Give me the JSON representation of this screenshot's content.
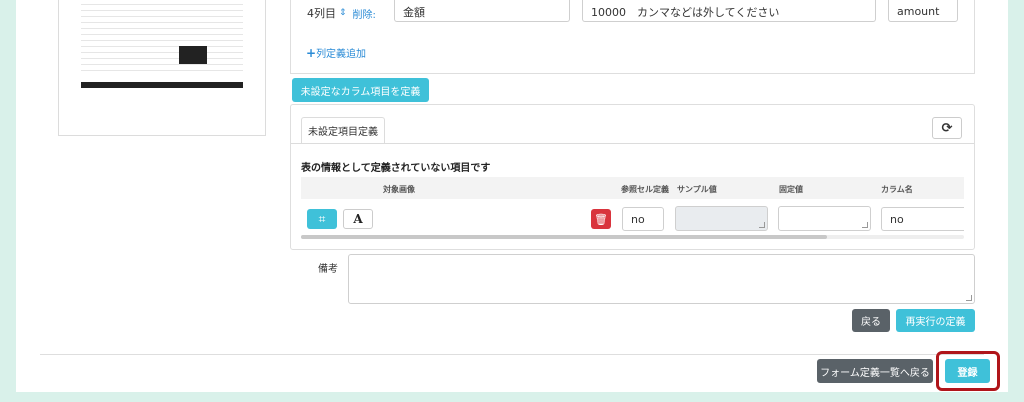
{
  "column_row": {
    "label": "4列目",
    "sort_icon": "sort-arrows-icon",
    "delete_label": "削除:",
    "title_value": "金額",
    "sample_value": "10000　カンマなどは外してください",
    "key_value": "amount"
  },
  "add_column_label": "列定義追加",
  "undefined_columns_button": "未設定なカラム項目を定義",
  "panel": {
    "tab_label": "未設定項目定義",
    "refresh_icon": "refresh-icon",
    "title": "表の情報として定義されていない項目です",
    "headers": {
      "image": "対象画像",
      "ref_cell": "参照セル定義",
      "sample": "サンプル値",
      "fixed": "固定値",
      "column_name": "カラム名"
    },
    "row": {
      "crop_icon": "crop-icon",
      "text_icon_label": "A",
      "trash_icon": "trash-icon",
      "ref_cell_value": "no",
      "sample_value": "",
      "fixed_value": "",
      "column_name_value": "no"
    }
  },
  "memo": {
    "label": "備考",
    "value": ""
  },
  "buttons": {
    "back": "戻る",
    "redefine": "再実行の定義",
    "back_to_list": "フォーム定義一覧へ戻る",
    "register": "登録"
  },
  "colors": {
    "teal": "#3fc1d9",
    "grey": "#5a6268",
    "danger": "#d9343d",
    "highlight": "#b0151a",
    "background": "#d9f1ea"
  }
}
